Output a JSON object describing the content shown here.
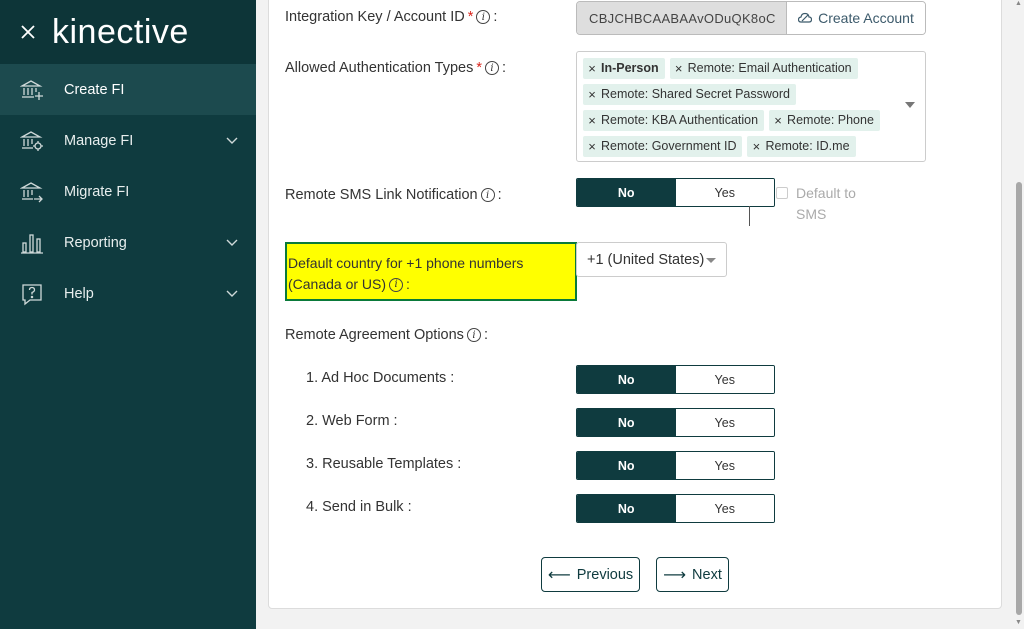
{
  "sidebar": {
    "logo": "kinective",
    "close_icon": "close-icon",
    "items": [
      {
        "label": "Create FI",
        "icon": "bank-plus-icon",
        "active": true,
        "has_chevron": false
      },
      {
        "label": "Manage FI",
        "icon": "bank-gear-icon",
        "active": false,
        "has_chevron": true
      },
      {
        "label": "Migrate FI",
        "icon": "bank-arrow-icon",
        "active": false,
        "has_chevron": false
      },
      {
        "label": "Reporting",
        "icon": "bar-chart-icon",
        "active": false,
        "has_chevron": true
      },
      {
        "label": "Help",
        "icon": "help-icon",
        "active": false,
        "has_chevron": true
      }
    ]
  },
  "form": {
    "integration_key": {
      "label": "Integration Key / Account ID",
      "value": "CBJCHBCAABAAvODuQK8oC",
      "create_account_label": "Create Account"
    },
    "auth_types": {
      "label": "Allowed Authentication Types",
      "tags": [
        [
          "In-Person",
          "Remote: Email Authentication"
        ],
        [
          "Remote: Shared Secret Password"
        ],
        [
          "Remote: KBA Authentication",
          "Remote: Phone"
        ],
        [
          "Remote: Government ID",
          "Remote: ID.me"
        ]
      ]
    },
    "sms_link": {
      "label": "Remote SMS Link Notification",
      "no": "No",
      "yes": "Yes",
      "default_to_sms": "Default to SMS"
    },
    "default_country": {
      "label_line1": "Default country for +1 phone numbers",
      "label_line2": "(Canada or US)",
      "value": "+1 (United States)"
    },
    "agreement": {
      "label": "Remote Agreement Options",
      "options": [
        {
          "label": "1. Ad Hoc Documents :",
          "no": "No",
          "yes": "Yes"
        },
        {
          "label": "2. Web Form :",
          "no": "No",
          "yes": "Yes"
        },
        {
          "label": "3. Reusable Templates :",
          "no": "No",
          "yes": "Yes"
        },
        {
          "label": "4. Send in Bulk :",
          "no": "No",
          "yes": "Yes"
        }
      ]
    },
    "previous_label": "Previous",
    "next_label": "Next"
  },
  "colors": {
    "sidebar": "#0f3b3f",
    "highlight": "#ffff00",
    "tag_bg": "#e2f1ec",
    "required": "#d9241b"
  }
}
